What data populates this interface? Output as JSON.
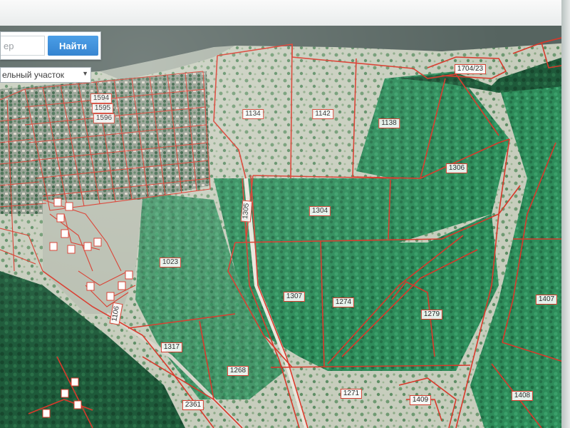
{
  "search": {
    "placeholder": "ер",
    "button_label": "Найти"
  },
  "type_select": {
    "selected": "ельный участок"
  },
  "parcels": [
    {
      "id": "1594",
      "label": "1594"
    },
    {
      "id": "1595",
      "label": "1595"
    },
    {
      "id": "1596",
      "label": "1596"
    },
    {
      "id": "1134",
      "label": "1134"
    },
    {
      "id": "1142",
      "label": "1142"
    },
    {
      "id": "1138",
      "label": "1138"
    },
    {
      "id": "1704/23",
      "label": "1704/23"
    },
    {
      "id": "1306",
      "label": "1306"
    },
    {
      "id": "1304",
      "label": "1304"
    },
    {
      "id": "1305",
      "label": "1305"
    },
    {
      "id": "1023",
      "label": "1023"
    },
    {
      "id": "1307",
      "label": "1307"
    },
    {
      "id": "1274",
      "label": "1274"
    },
    {
      "id": "1279",
      "label": "1279"
    },
    {
      "id": "1407",
      "label": "1407"
    },
    {
      "id": "1317",
      "label": "1317"
    },
    {
      "id": "1268",
      "label": "1268"
    },
    {
      "id": "1271",
      "label": "1271"
    },
    {
      "id": "1409",
      "label": "1409"
    },
    {
      "id": "1408",
      "label": "1408"
    },
    {
      "id": "2361",
      "label": "2361"
    },
    {
      "id": "1106",
      "label": "1106"
    }
  ],
  "colors": {
    "boundary": "#d8382a",
    "forest": "#2f8f5c",
    "clearing": "#c9cfc0",
    "water": "#5f6a66",
    "search_button": "#1a7fd6"
  }
}
